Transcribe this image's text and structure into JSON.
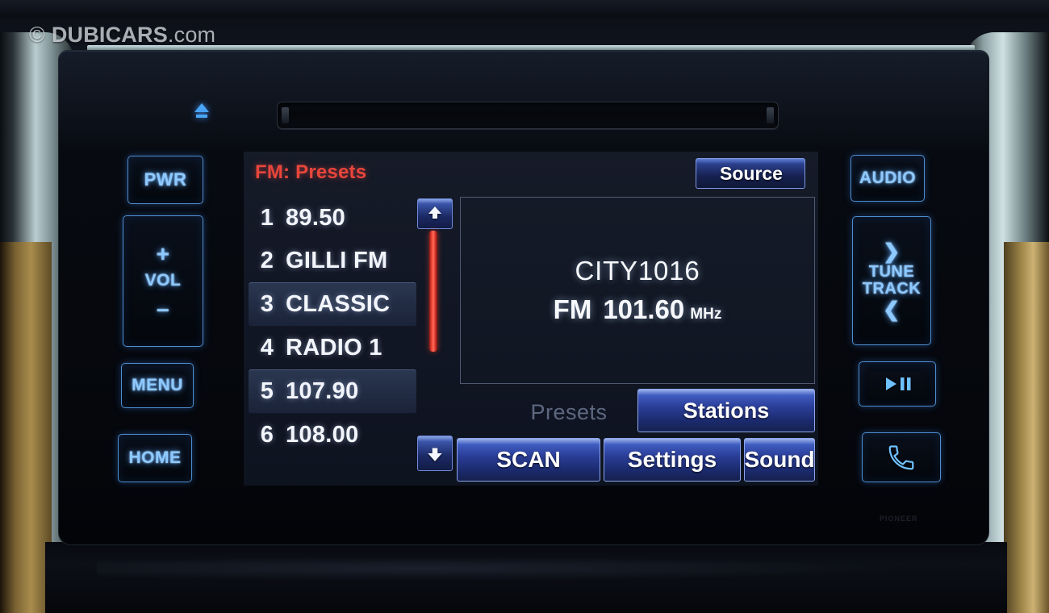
{
  "watermark": {
    "copyright": "©",
    "brand": "DUBICARS",
    "tld": ".com"
  },
  "head_unit": {
    "eject_icon": "eject-icon",
    "cd_slot_label": "cd-slot",
    "faint_model_mark": "PIONEER"
  },
  "left_buttons": [
    {
      "id": "pwr",
      "label": "PWR"
    },
    {
      "id": "vol",
      "label": "VOL",
      "plus": "+",
      "minus": "–"
    },
    {
      "id": "menu",
      "label": "MENU"
    },
    {
      "id": "home",
      "label": "HOME"
    }
  ],
  "right_buttons": [
    {
      "id": "audio",
      "label": "AUDIO"
    },
    {
      "id": "tune-track",
      "line1": "TUNE",
      "line2": "TRACK",
      "next": "❯",
      "prev": "❮"
    },
    {
      "id": "play-pause",
      "label": "▶❚❚"
    },
    {
      "id": "phone",
      "label": "phone-handset"
    }
  ],
  "screen": {
    "title": "FM: Presets",
    "title_color": "#e8463c",
    "source_button": {
      "label": "Source",
      "icon": "phone-disconnected-icon"
    },
    "presets": [
      {
        "number": "1",
        "name": "89.50",
        "highlighted": false
      },
      {
        "number": "2",
        "name": "GILLI FM",
        "highlighted": false
      },
      {
        "number": "3",
        "name": "CLASSIC",
        "highlighted": true
      },
      {
        "number": "4",
        "name": "RADIO 1",
        "highlighted": false
      },
      {
        "number": "5",
        "name": "107.90",
        "highlighted": true
      },
      {
        "number": "6",
        "name": "108.00",
        "highlighted": false
      }
    ],
    "scroll": {
      "up_icon": "▲",
      "down_icon": "▼",
      "thumb_color": "#ef4436"
    },
    "now_playing": {
      "call_sign": "CITY1016",
      "band": "FM",
      "frequency": "101.60",
      "unit": "MHz"
    },
    "tabs": [
      {
        "id": "presets",
        "label": "Presets",
        "active": false
      },
      {
        "id": "stations",
        "label": "Stations",
        "active": true
      }
    ],
    "softkeys": [
      {
        "id": "scan",
        "label": "SCAN"
      },
      {
        "id": "settings",
        "label": "Settings"
      },
      {
        "id": "sound",
        "label": "Sound"
      }
    ]
  }
}
